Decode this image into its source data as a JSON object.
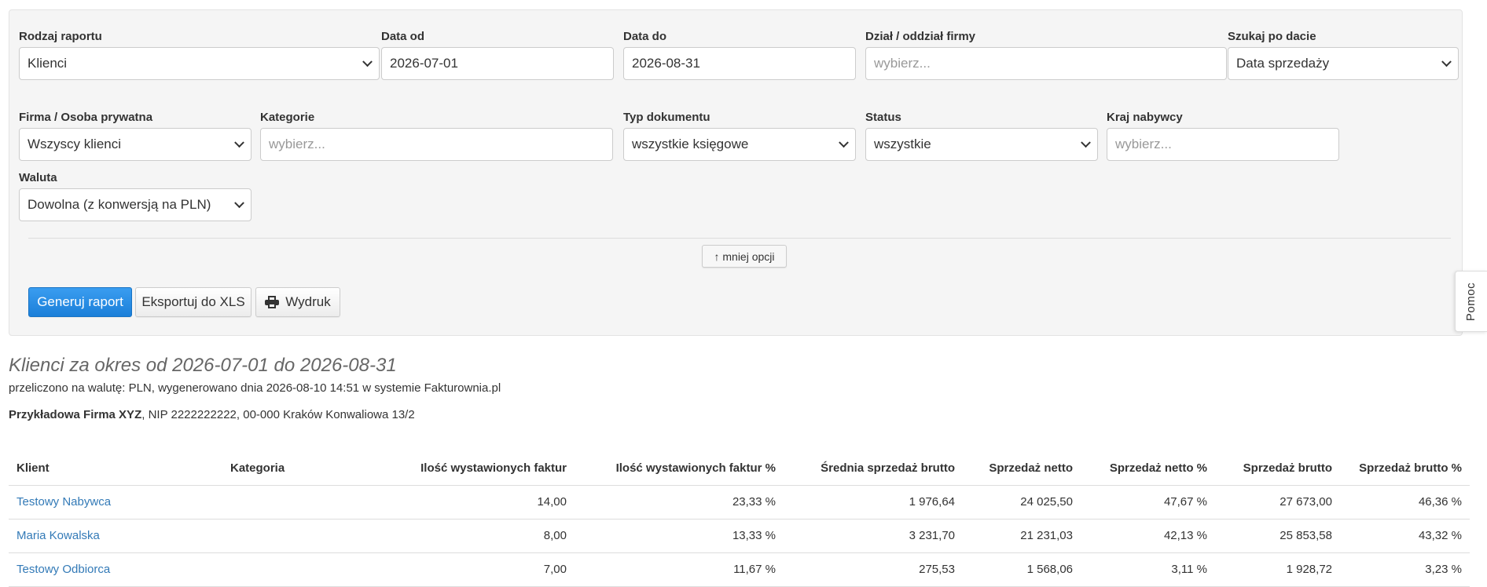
{
  "filters": {
    "report_type": {
      "label": "Rodzaj raportu",
      "value": "Klienci"
    },
    "date_from": {
      "label": "Data od",
      "value": "2026-07-01"
    },
    "date_to": {
      "label": "Data do",
      "value": "2026-08-31"
    },
    "department": {
      "label": "Dział / oddział firmy",
      "placeholder": "wybierz..."
    },
    "search_by_date": {
      "label": "Szukaj po dacie",
      "value": "Data sprzedaży"
    },
    "client_type": {
      "label": "Firma / Osoba prywatna",
      "value": "Wszyscy klienci"
    },
    "categories": {
      "label": "Kategorie",
      "placeholder": "wybierz..."
    },
    "document_type": {
      "label": "Typ dokumentu",
      "value": "wszystkie księgowe"
    },
    "status": {
      "label": "Status",
      "value": "wszystkie"
    },
    "buyer_country": {
      "label": "Kraj nabywcy",
      "placeholder": "wybierz..."
    },
    "currency": {
      "label": "Waluta",
      "value": "Dowolna (z konwersją na PLN)"
    }
  },
  "less_options_label": "↑ mniej opcji",
  "buttons": {
    "generate": "Generuj raport",
    "export_xls": "Eksportuj do XLS",
    "print": "Wydruk"
  },
  "help_tab": "Pomoc",
  "report": {
    "title": "Klienci za okres od 2026-07-01 do 2026-08-31",
    "subtitle": "przeliczono na walutę: PLN, wygenerowano dnia 2026-08-10 14:51 w systemie Fakturownia.pl",
    "company_name": "Przykładowa Firma XYZ",
    "company_details": ", NIP 2222222222, 00-000 Kraków Konwaliowa 13/2"
  },
  "table": {
    "columns": [
      "Klient",
      "Kategoria",
      "Ilość wystawionych faktur",
      "Ilość wystawionych faktur %",
      "Średnia sprzedaż brutto",
      "Sprzedaż netto",
      "Sprzedaż netto %",
      "Sprzedaż brutto",
      "Sprzedaż brutto %"
    ],
    "rows": [
      [
        "Testowy Nabywca",
        "",
        "14,00",
        "23,33 %",
        "1 976,64",
        "24 025,50",
        "47,67 %",
        "27 673,00",
        "46,36 %"
      ],
      [
        "Maria Kowalska",
        "",
        "8,00",
        "13,33 %",
        "3 231,70",
        "21 231,03",
        "42,13 %",
        "25 853,58",
        "43,32 %"
      ],
      [
        "Testowy Odbiorca",
        "",
        "7,00",
        "11,67 %",
        "275,53",
        "1 568,06",
        "3,11 %",
        "1 928,72",
        "3,23 %"
      ]
    ]
  },
  "colors": {
    "link": "#337ab7",
    "primary_button": "#1b7fd9",
    "panel_bg": "#f5f5f5"
  }
}
